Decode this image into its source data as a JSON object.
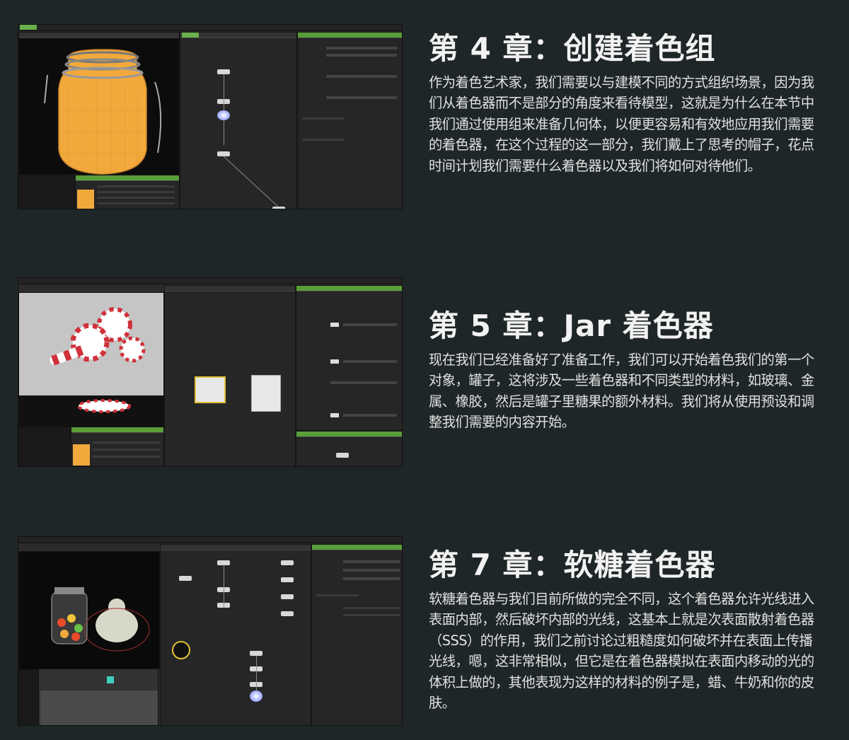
{
  "chapters": [
    {
      "title": "第 4 章：创建着色组",
      "body": "作为着色艺术家，我们需要以与建模不同的方式组织场景，因为我们从着色器而不是部分的角度来看待模型，这就是为什么在本节中我们通过使用组来准备几何体，以便更容易和有效地应用我们需要的着色器，在这个过程的这一部分，我们戴上了思考的帽子，花点时间计划我们需要什么着色器以及我们将如何对待他们。"
    },
    {
      "title": "第 5 章：Jar 着色器",
      "body": "现在我们已经准备好了准备工作，我们可以开始着色我们的第一个对象，罐子，这将涉及一些着色器和不同类型的材料，如玻璃、金属、橡胶，然后是罐子里糖果的额外材料。我们将从使用预设和调整我们需要的内容开始。"
    },
    {
      "title": "第 7 章：软糖着色器",
      "body": "软糖着色器与我们目前所做的完全不同，这个着色器允许光线进入表面内部，然后破坏内部的光线，这基本上就是次表面散射着色器（SSS）的作用，我们之前讨论过粗糙度如何破坏并在表面上传播光线，嗯，这非常相似，但它是在着色器模拟在表面内移动的光的体积上做的，其他表现为这样的材料的例子是，蜡、牛奶和你的皮肤。"
    }
  ],
  "colors": {
    "background": "#1f2628",
    "accent_green": "#6ab04c",
    "jar_orange": "#f2a93b"
  }
}
